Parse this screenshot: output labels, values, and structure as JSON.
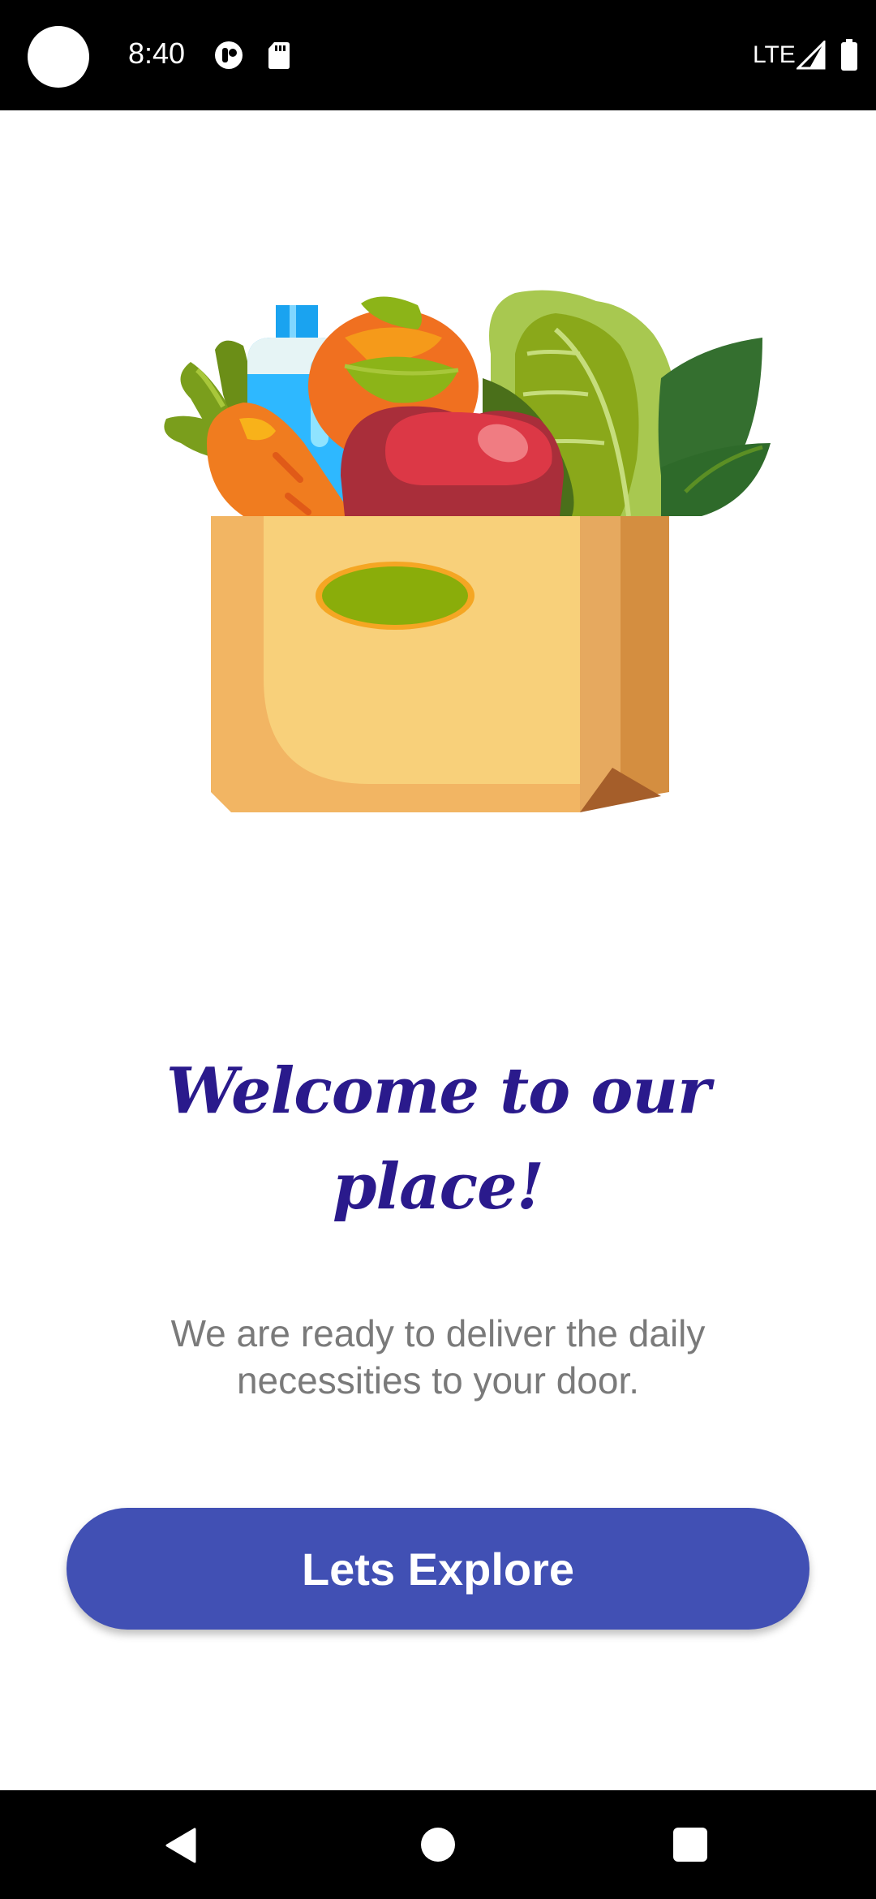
{
  "status_bar": {
    "time": "8:40",
    "network": "LTE",
    "icons": [
      "camera-cutout-icon",
      "privacy-indicator-icon",
      "sd-card-icon",
      "signal-icon",
      "battery-icon"
    ]
  },
  "main": {
    "illustration": "grocery-bag-with-vegetables-illustration",
    "title": "Welcome to our place!",
    "subtitle": "We are ready to deliver the daily necessities to your door.",
    "button_label": "Lets Explore"
  },
  "nav_bar": {
    "icons": [
      "back-icon",
      "home-icon",
      "recents-icon"
    ]
  },
  "colors": {
    "title": "#2a1a8c",
    "button": "#4150b4",
    "subtitle": "#7a7a7a",
    "background": "#ffffff"
  }
}
